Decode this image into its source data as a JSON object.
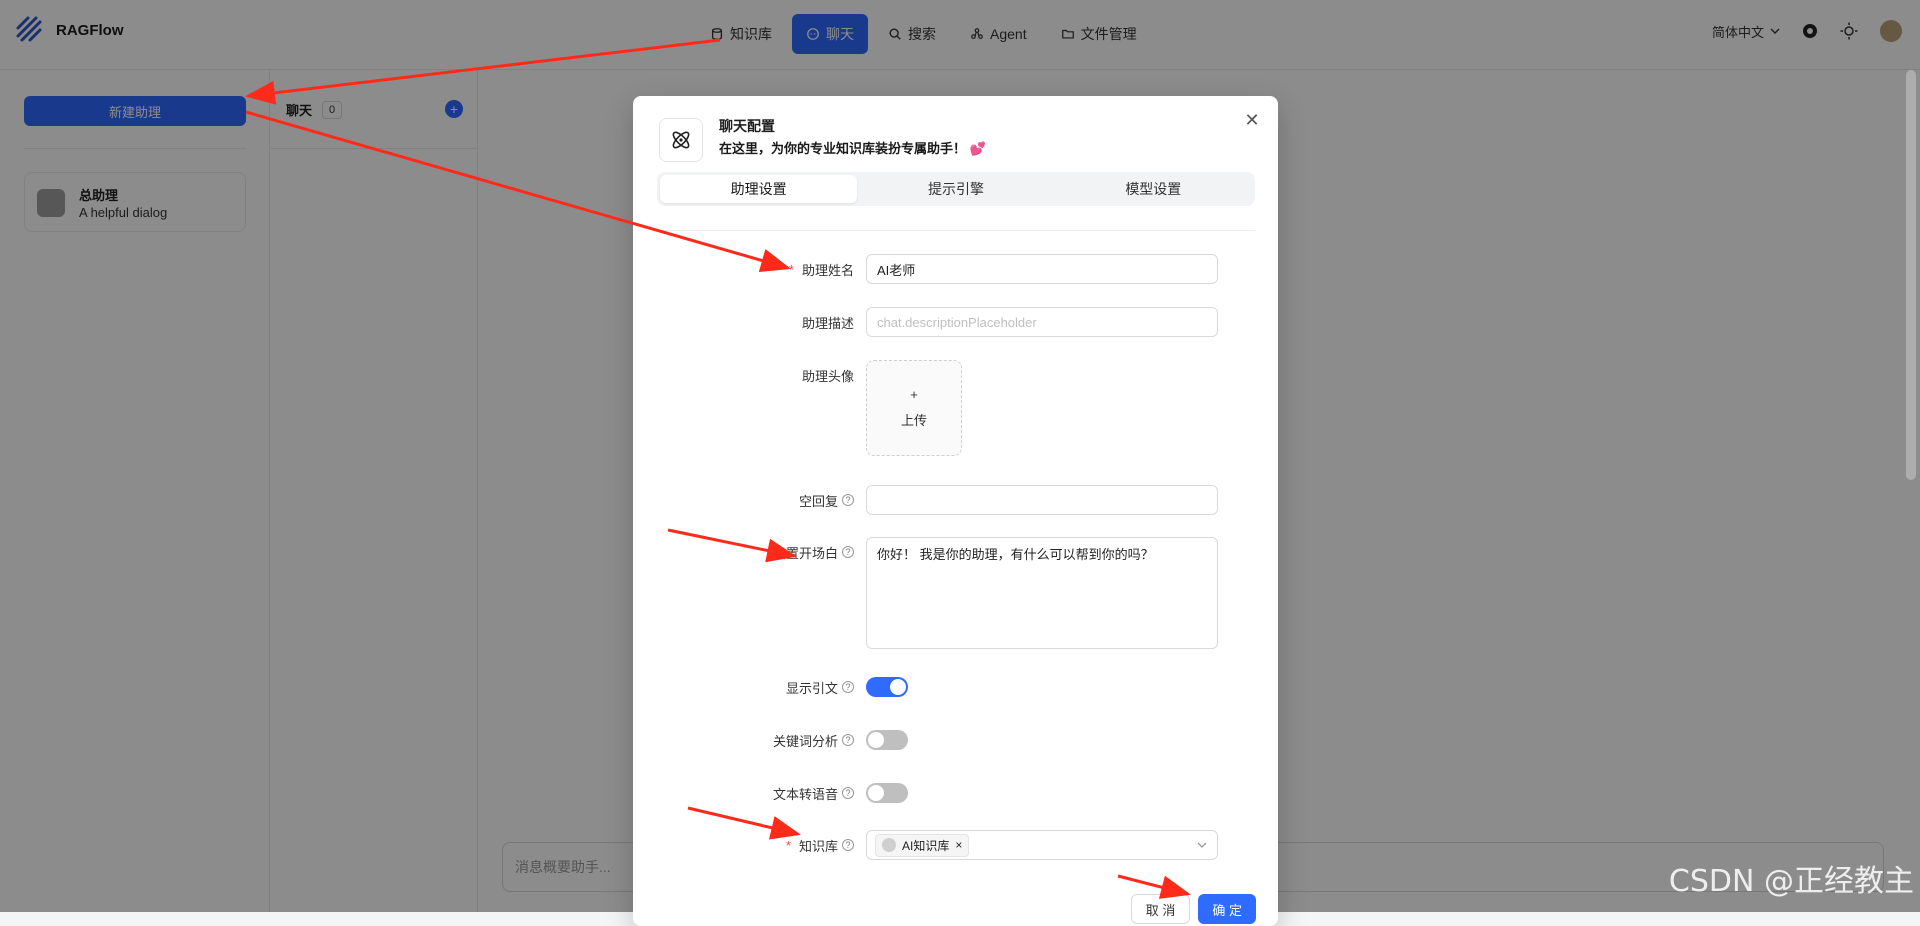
{
  "app": {
    "brand": "RAGFlow",
    "nav": [
      {
        "label": "知识库",
        "icon": "database-icon"
      },
      {
        "label": "聊天",
        "icon": "chat-icon",
        "active": true
      },
      {
        "label": "搜索",
        "icon": "search-icon"
      },
      {
        "label": "Agent",
        "icon": "agent-icon"
      },
      {
        "label": "文件管理",
        "icon": "folder-icon"
      }
    ],
    "header_right": {
      "language": "简体中文"
    }
  },
  "sidebar": {
    "new_button": "新建助理",
    "assistant": {
      "name": "总助理",
      "description": "A helpful dialog"
    }
  },
  "chatlist": {
    "title": "聊天",
    "count": "0"
  },
  "main": {
    "input_placeholder": "消息概要助手..."
  },
  "modal": {
    "title": "聊天配置",
    "subtitle": "在这里，为你的专业知识库装扮专属助手！",
    "tabs": [
      "助理设置",
      "提示引擎",
      "模型设置"
    ],
    "fields": {
      "assistant_name": {
        "label": "助理姓名",
        "value": "AI老师",
        "required": true
      },
      "assistant_desc": {
        "label": "助理描述",
        "placeholder": "chat.descriptionPlaceholder"
      },
      "assistant_avatar": {
        "label": "助理头像",
        "upload_plus": "+",
        "upload_text": "上传"
      },
      "empty_reply": {
        "label": "空回复",
        "value": ""
      },
      "opening": {
        "label": "设置开场白",
        "value": "你好！ 我是你的助理，有什么可以帮到你的吗？"
      },
      "show_quote": {
        "label": "显示引文",
        "on": true
      },
      "keyword": {
        "label": "关键词分析",
        "on": false
      },
      "tts": {
        "label": "文本转语音",
        "on": false
      },
      "knowledge": {
        "label": "知识库",
        "required": true,
        "tag": "AI知识库",
        "tag_remove": "×"
      }
    },
    "buttons": {
      "cancel": "取 消",
      "ok": "确 定"
    }
  },
  "watermark": "CSDN @正经教主",
  "colors": {
    "accent": "#2f6bff",
    "arrow": "#ff2a1a"
  }
}
